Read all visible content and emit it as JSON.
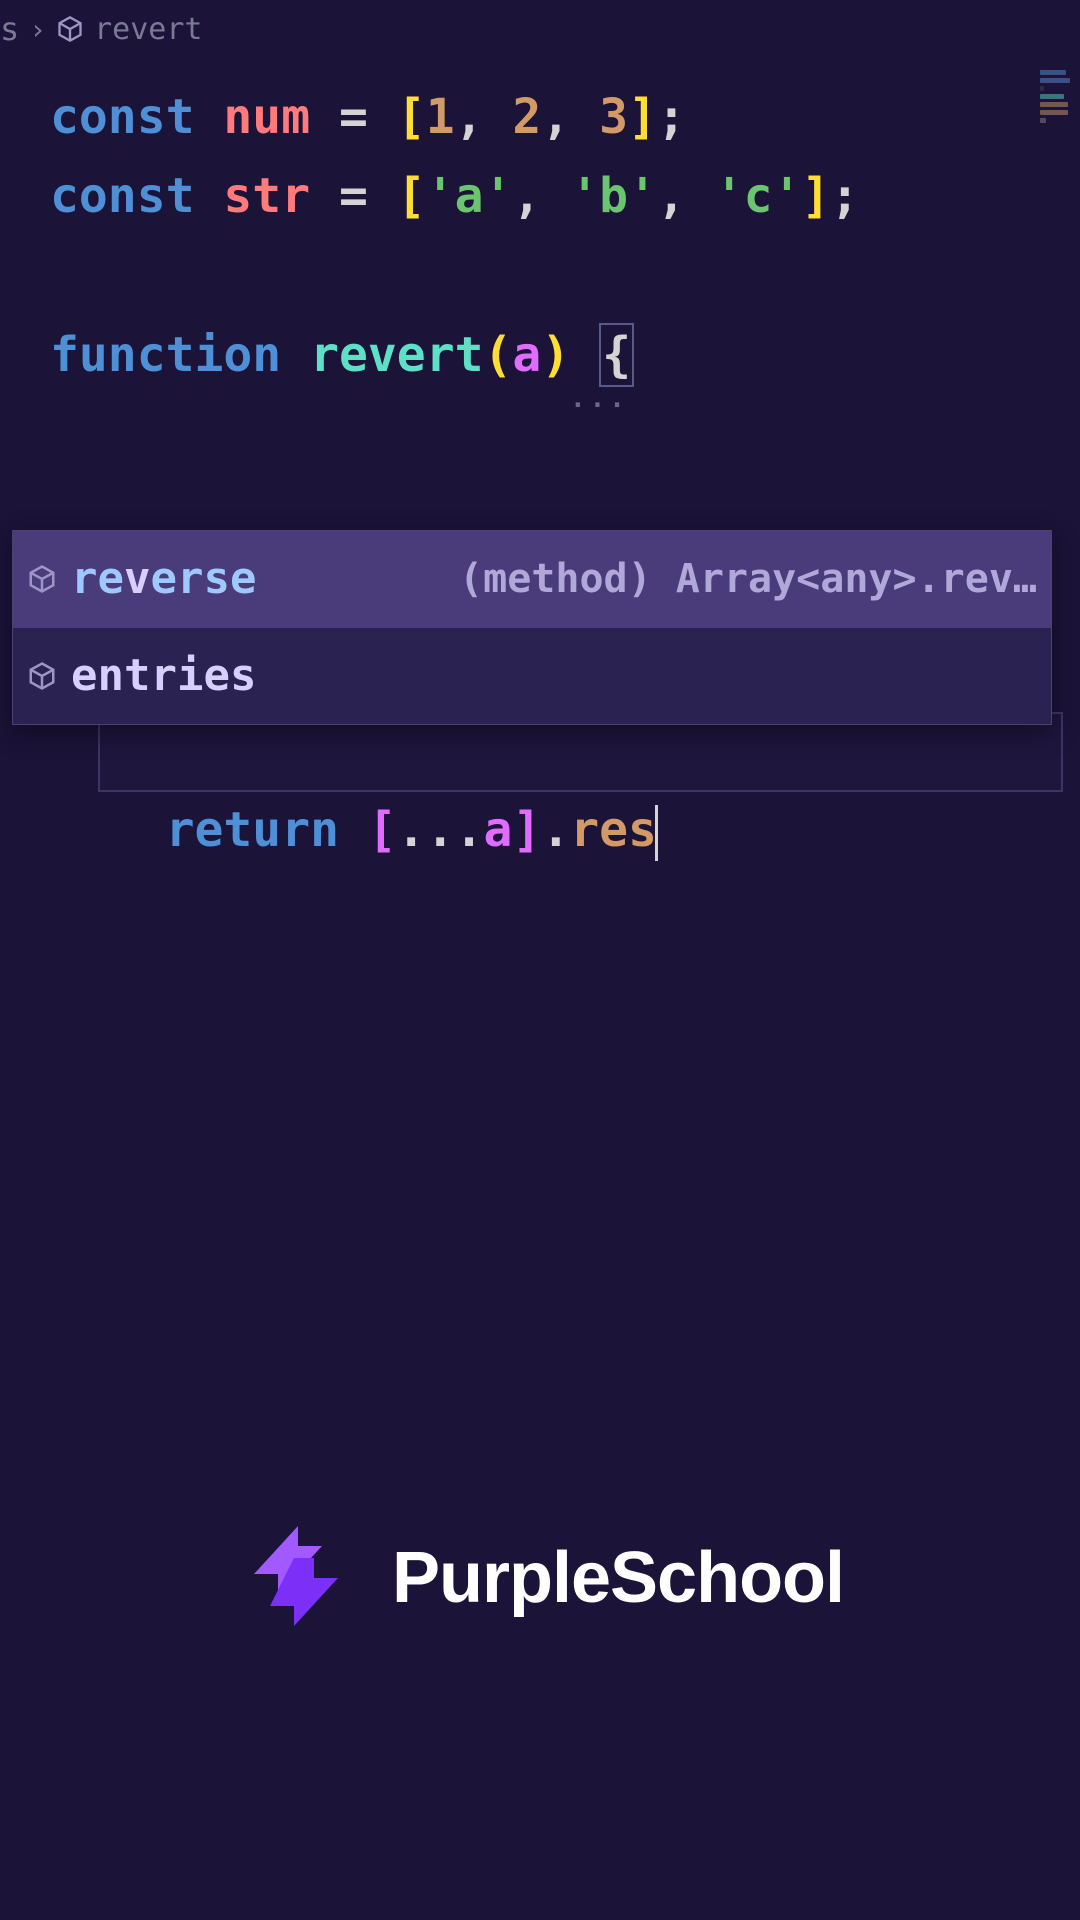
{
  "breadcrumb": {
    "prefix": "s",
    "symbol": "revert"
  },
  "code": {
    "line1": {
      "kw": "const",
      "var": "num",
      "eq": " = ",
      "open": "[",
      "v1": "1",
      "c1": ", ",
      "v2": "2",
      "c2": ", ",
      "v3": "3",
      "close": "]",
      "semi": ";"
    },
    "line2": {
      "kw": "const",
      "var": "str",
      "eq": " = ",
      "open": "[",
      "v1": "'a'",
      "c1": ", ",
      "v2": "'b'",
      "c2": ", ",
      "v3": "'c'",
      "close": "]",
      "semi": ";"
    },
    "line4": {
      "kw": "function",
      "name": "revert",
      "lp": "(",
      "param": "a",
      "rp": ")",
      "brace": "{"
    },
    "hint": "...",
    "line5": {
      "indent": "    ",
      "kw": "return",
      "sp": " ",
      "open": "[",
      "spread": "...",
      "var": "a",
      "close": "]",
      "dot": ".",
      "typed": "res"
    }
  },
  "autocomplete": {
    "items": [
      {
        "pre": "re",
        "mid": "v",
        "post": "erse",
        "hint": "(method) Array<any>.rev…",
        "selected": true
      },
      {
        "pre": "",
        "mid": "entries",
        "post": "",
        "hint": "",
        "selected": false
      }
    ]
  },
  "brand": {
    "name": "PurpleSchool"
  },
  "colors": {
    "bg": "#1b1338",
    "accent": "#a259ff"
  }
}
